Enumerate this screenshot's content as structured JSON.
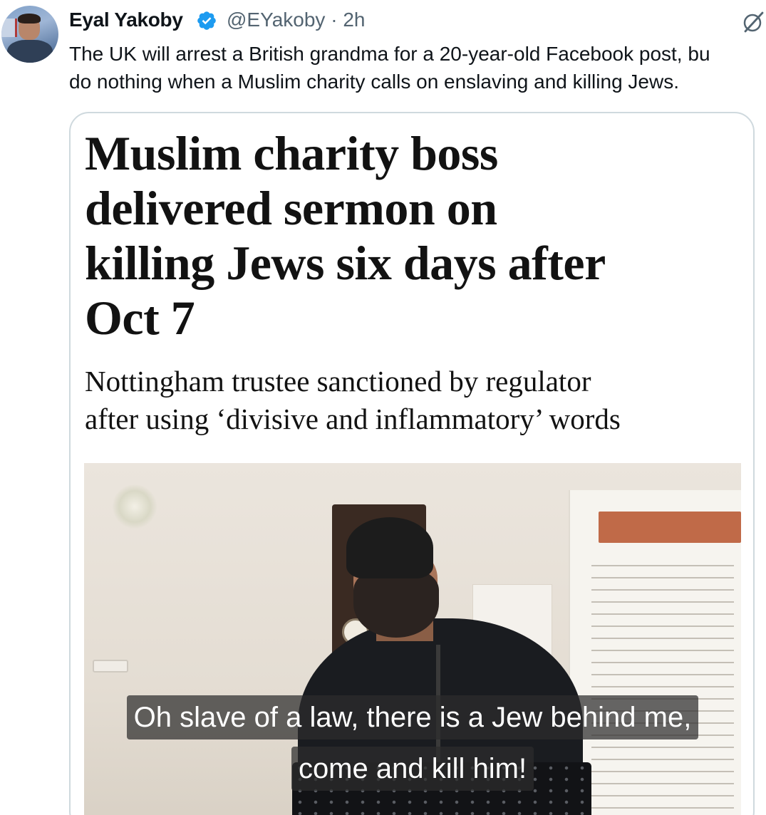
{
  "tweet": {
    "author_name": "Eyal Yakoby",
    "author_handle": "@EYakoby",
    "separator": "·",
    "time_ago": "2h",
    "text_lines": [
      "The UK will arrest a British grandma for a 20-year-old Facebook post, bu",
      "do nothing when a Muslim charity calls on enslaving and killing Jews."
    ],
    "verified_color": "#1d9bf0"
  },
  "article": {
    "headline_lines": [
      "Muslim charity boss",
      "delivered sermon on",
      "killing Jews six days after",
      "Oct 7"
    ],
    "subhead_lines": [
      "Nottingham trustee sanctioned by regulator",
      "after using ‘divisive and inflammatory’ words"
    ]
  },
  "video": {
    "caption_line_1": "Oh slave of a law, there is a Jew behind me,",
    "caption_line_2": "come and kill him!"
  }
}
